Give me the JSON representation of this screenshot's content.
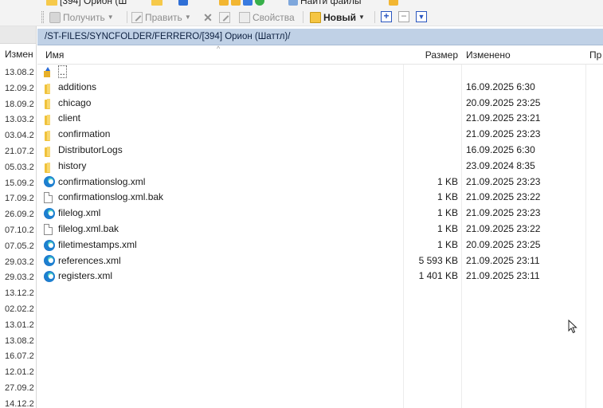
{
  "toolbar_top": {
    "items": [
      {
        "label": "[394] Орион (Ш",
        "icon": "folder-icon"
      },
      {
        "label": "Найти файлы",
        "icon": "search-icon"
      }
    ]
  },
  "toolbar": {
    "get_label": "Получить",
    "edit_label": "Править",
    "properties_label": "Свойства",
    "new_label": "Новый",
    "expand_symbol": "+",
    "collapse_symbol": "−",
    "filter_symbol": "▼"
  },
  "left_panel": {
    "header": "Измен",
    "dates": [
      "13.08.2",
      "12.09.2",
      "18.09.2",
      "13.03.2",
      "03.04.2",
      "21.07.2",
      "05.03.2",
      "15.09.2",
      "17.09.2",
      "26.09.2",
      "07.10.2",
      "07.05.2",
      "29.03.2",
      "29.03.2",
      "13.12.2",
      "02.02.2",
      "13.01.2",
      "13.08.2",
      "16.07.2",
      "12.01.2",
      "27.09.2",
      "14.12.2"
    ]
  },
  "path": "/ST-FILES/SYNCFOLDER/FERRERO/[394] Орион (Шаттл)/",
  "columns": {
    "name": "Имя",
    "size": "Размер",
    "modified": "Изменено",
    "extra": "Пр"
  },
  "files": [
    {
      "name": "..",
      "size": "",
      "modified": "",
      "type": "updir"
    },
    {
      "name": "additions",
      "size": "",
      "modified": "16.09.2025 6:30",
      "type": "folder"
    },
    {
      "name": "chicago",
      "size": "",
      "modified": "20.09.2025 23:25",
      "type": "folder"
    },
    {
      "name": "client",
      "size": "",
      "modified": "21.09.2025 23:21",
      "type": "folder"
    },
    {
      "name": "confirmation",
      "size": "",
      "modified": "21.09.2025 23:23",
      "type": "folder"
    },
    {
      "name": "DistributorLogs",
      "size": "",
      "modified": "16.09.2025 6:30",
      "type": "folder"
    },
    {
      "name": "history",
      "size": "",
      "modified": "23.09.2024 8:35",
      "type": "folder"
    },
    {
      "name": "confirmationslog.xml",
      "size": "1 KB",
      "modified": "21.09.2025 23:23",
      "type": "xml"
    },
    {
      "name": "confirmationslog.xml.bak",
      "size": "1 KB",
      "modified": "21.09.2025 23:22",
      "type": "doc"
    },
    {
      "name": "filelog.xml",
      "size": "1 KB",
      "modified": "21.09.2025 23:23",
      "type": "xml"
    },
    {
      "name": "filelog.xml.bak",
      "size": "1 KB",
      "modified": "21.09.2025 23:22",
      "type": "doc"
    },
    {
      "name": "filetimestamps.xml",
      "size": "1 KB",
      "modified": "20.09.2025 23:25",
      "type": "xml"
    },
    {
      "name": "references.xml",
      "size": "5 593 KB",
      "modified": "21.09.2025 23:11",
      "type": "xml"
    },
    {
      "name": "registers.xml",
      "size": "1 401 KB",
      "modified": "21.09.2025 23:11",
      "type": "xml"
    }
  ]
}
